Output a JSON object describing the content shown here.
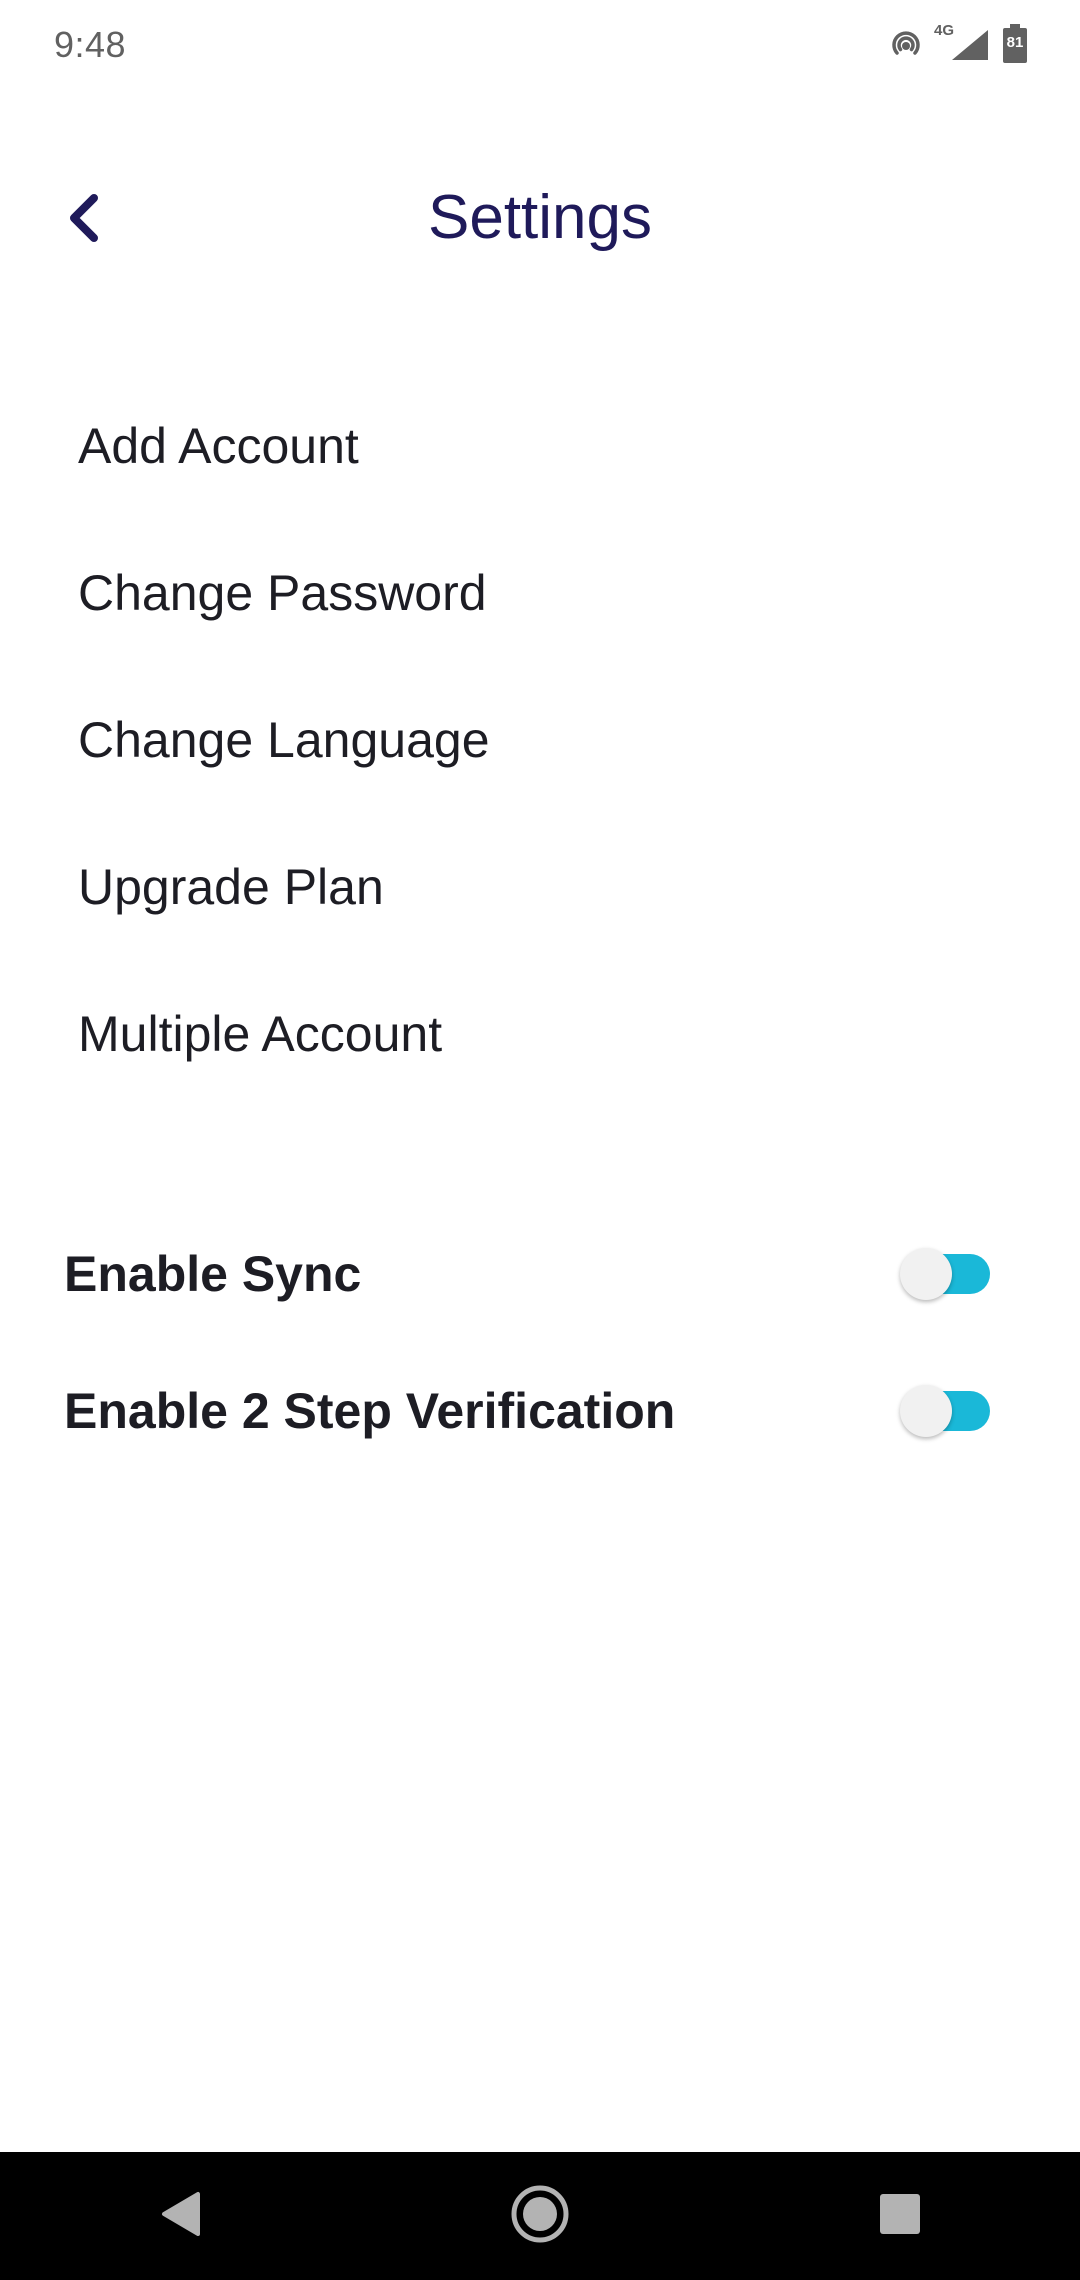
{
  "status_bar": {
    "time": "9:48",
    "network_label": "4G",
    "battery_level": "81",
    "icons": [
      "hotspot-icon",
      "signal-icon",
      "battery-icon"
    ]
  },
  "header": {
    "title": "Settings",
    "back_icon": "chevron-left-icon",
    "title_color": "#1f1a5a"
  },
  "menu": {
    "items": [
      {
        "label": "Add Account"
      },
      {
        "label": "Change Password"
      },
      {
        "label": "Change Language"
      },
      {
        "label": "Upgrade Plan"
      },
      {
        "label": "Multiple Account"
      }
    ]
  },
  "toggles": [
    {
      "label": "Enable Sync",
      "track_color": "#1ab8d8"
    },
    {
      "label": "Enable 2 Step Verification",
      "track_color": "#1ab8d8"
    }
  ],
  "nav_bar": {
    "icons": [
      "back-triangle-icon",
      "home-circle-icon",
      "recents-square-icon"
    ]
  }
}
